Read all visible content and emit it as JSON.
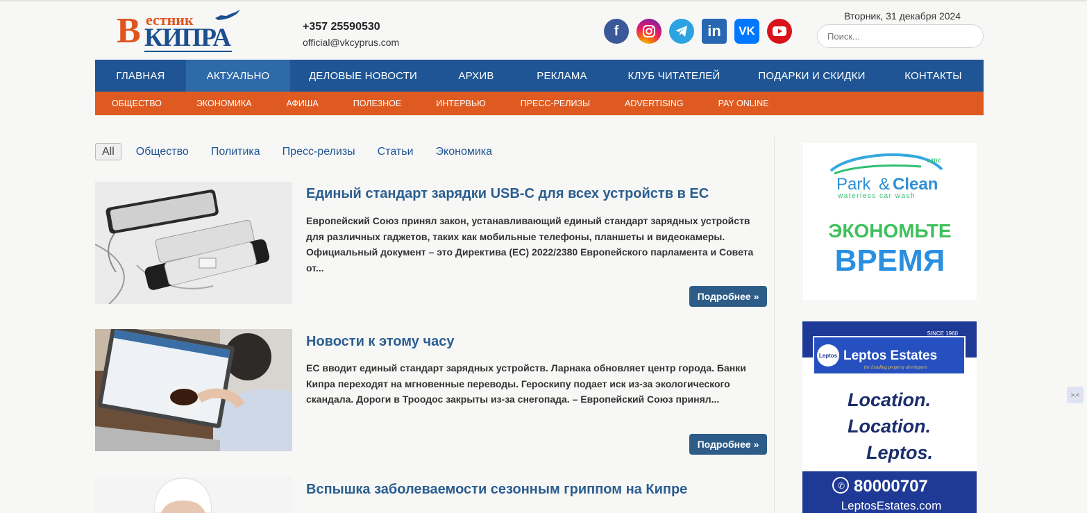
{
  "header": {
    "logo_line1": "естник",
    "logo_letter": "В",
    "logo_line2": "КИПРА",
    "phone": "+357 25590530",
    "email": "official@vkcyprus.com",
    "date": "Вторник, 31 декабря 2024",
    "search_placeholder": "Поиск...",
    "socials": [
      {
        "icon": "facebook-icon",
        "glyph": "f"
      },
      {
        "icon": "instagram-icon",
        "glyph": ""
      },
      {
        "icon": "telegram-icon",
        "glyph": ""
      },
      {
        "icon": "linkedin-icon",
        "glyph": "in"
      },
      {
        "icon": "vk-icon",
        "glyph": "VK"
      },
      {
        "icon": "youtube-icon",
        "glyph": ""
      }
    ]
  },
  "main_nav": [
    "ГЛАВНАЯ",
    "АКТУАЛЬНО",
    "ДЕЛОВЫЕ НОВОСТИ",
    "АРХИВ",
    "РЕКЛАМА",
    "КЛУБ ЧИТАТЕЛЕЙ",
    "ПОДАРКИ И СКИДКИ",
    "КОНТАКТЫ"
  ],
  "main_nav_active": "АКТУАЛЬНО",
  "sub_nav": [
    "ОБЩЕСТВО",
    "ЭКОНОМИКА",
    "АФИША",
    "ПОЛЕЗНОЕ",
    "ИНТЕРВЬЮ",
    "ПРЕСС-РЕЛИЗЫ",
    "ADVERTISING",
    "PAY ONLINE"
  ],
  "filters": {
    "all": "All",
    "links": [
      "Общество",
      "Политика",
      "Пресс-релизы",
      "Статьи",
      "Экономика"
    ]
  },
  "articles": [
    {
      "title": "Единый стандарт зарядки USB-C для всех устройств в ЕС",
      "excerpt": "Европейский Союз принял закон, устанавливающий единый стандарт зарядных устройств для различных гаджетов, таких как мобильные телефоны, планшеты и видеокамеры. Официальный документ – это Директива (ЕС) 2022/2380 Европейского парламента и Совета от...",
      "more": "Подробнее »"
    },
    {
      "title": "Новости к этому часу",
      "excerpt": "ЕС вводит единый стандарт зарядных устройств. Ларнака обновляет центр города. Банки Кипра переходят на мгновенные переводы. Героскипу подает иск из-за экологического скандала. Дороги в Троодос закрыты из-за снегопада. – Европейский Союз принял...",
      "more": "Подробнее »"
    },
    {
      "title": "Вспышка заболеваемости сезонным гриппом на Кипре",
      "excerpt": "",
      "more": ""
    }
  ],
  "ads": {
    "ad1": {
      "brand_a": "Park",
      "brand_amp": "&",
      "brand_b": "Clean",
      "tagline": "waterless car wash",
      "wm": "wmc",
      "line1": "ЭКОНОМЬТЕ",
      "line2": "ВРЕМЯ"
    },
    "ad2": {
      "since": "SINCE 1960",
      "logo_badge": "Leptos",
      "brand": "Leptos Estates",
      "sub": "the Leading property developers",
      "l1": "Location.",
      "l2": "Location.",
      "l3": "Leptos.",
      "phone": "80000707",
      "site": "LeptosEstates.com"
    }
  },
  "colors": {
    "nav_blue": "#1f5594",
    "nav_active": "#2e69a8",
    "subnav_orange": "#df5a20",
    "title_blue": "#2b5e8f",
    "button_blue": "#2d5c88"
  }
}
